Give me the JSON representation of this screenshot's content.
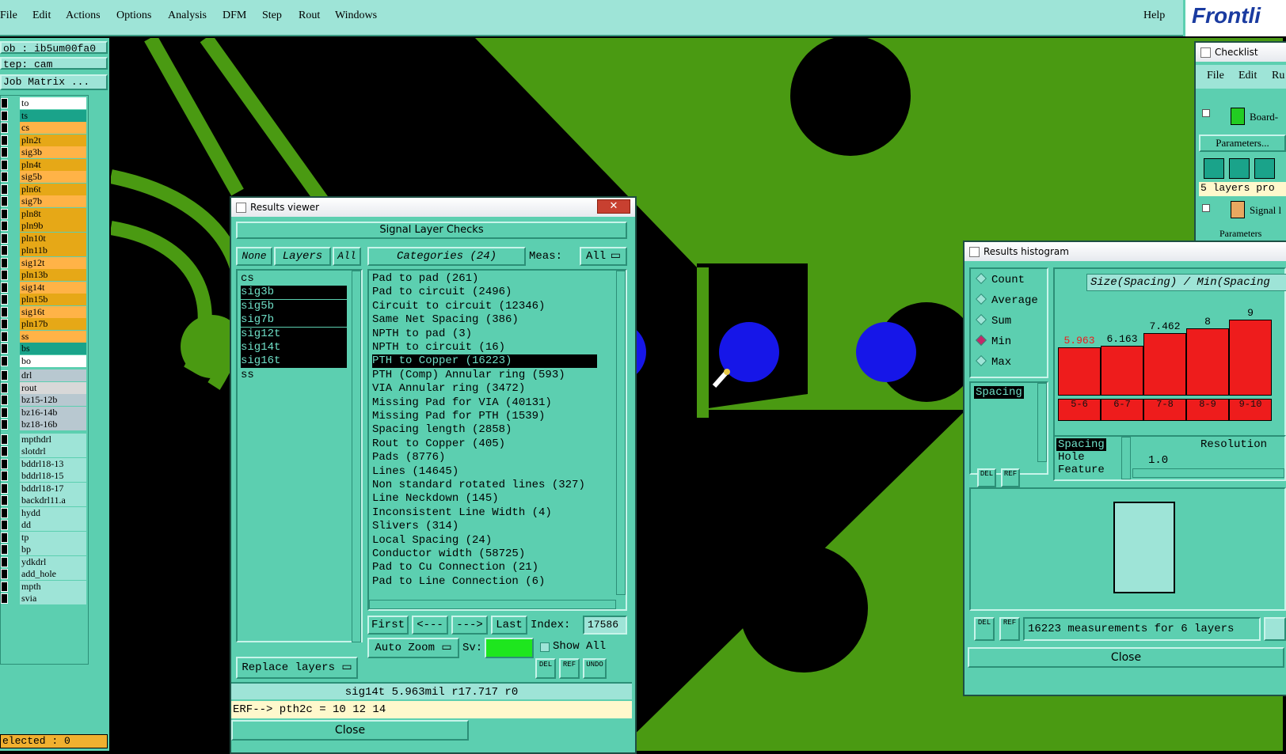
{
  "menubar": {
    "items": [
      "File",
      "Edit",
      "Actions",
      "Options",
      "Analysis",
      "DFM",
      "Step",
      "Rout",
      "Windows"
    ],
    "help": "Help",
    "logo": "Frontli"
  },
  "left": {
    "job": "ob : ib5um00fa0",
    "step": "tep: cam",
    "matrix": "Job Matrix ...",
    "layers_top": [
      {
        "name": "to",
        "color": "#ffffff"
      },
      {
        "name": "ts",
        "color": "#1aa38a"
      },
      {
        "name": "cs",
        "color": "#ffb347"
      },
      {
        "name": "pln2t",
        "color": "#e6a817"
      },
      {
        "name": "sig3b",
        "color": "#ffb347"
      },
      {
        "name": "pln4t",
        "color": "#e6a817"
      },
      {
        "name": "sig5b",
        "color": "#ffb347"
      },
      {
        "name": "pln6t",
        "color": "#e6a817"
      },
      {
        "name": "sig7b",
        "color": "#ffb347"
      },
      {
        "name": "pln8t",
        "color": "#e6a817"
      },
      {
        "name": "pln9b",
        "color": "#e6a817"
      },
      {
        "name": "pln10t",
        "color": "#e6a817"
      },
      {
        "name": "pln11b",
        "color": "#e6a817"
      },
      {
        "name": "sig12t",
        "color": "#ffb347"
      },
      {
        "name": "pln13b",
        "color": "#e6a817"
      },
      {
        "name": "sig14t",
        "color": "#ffb347"
      },
      {
        "name": "pln15b",
        "color": "#e6a817"
      },
      {
        "name": "sig16t",
        "color": "#ffb347"
      },
      {
        "name": "pln17b",
        "color": "#e6a817"
      },
      {
        "name": "ss",
        "color": "#ffb347"
      },
      {
        "name": "bs",
        "color": "#1aa38a"
      },
      {
        "name": "bo",
        "color": "#ffffff"
      }
    ],
    "layers_mid": [
      {
        "name": "drl",
        "color": "#b8c8d0"
      },
      {
        "name": "rout",
        "color": "#d8d8d8"
      },
      {
        "name": "bz15-12b",
        "color": "#b8c8d0"
      },
      {
        "name": "bz16-14b",
        "color": "#b8c8d0"
      },
      {
        "name": "bz18-16b",
        "color": "#b8c8d0"
      }
    ],
    "layers_bot": [
      "mpthdrl",
      "slotdrl",
      "bddrl18-13",
      "bddrl18-15",
      "bddrl18-17",
      "backdrl11.a",
      "hydd",
      "dd",
      "tp",
      "bp",
      "ydkdrl",
      "add_hole",
      "mpth",
      "svia"
    ],
    "selected": "elected : 0"
  },
  "results_viewer": {
    "title": "Results viewer",
    "header": "Signal Layer Checks",
    "btn_none": "None",
    "btn_layers": "Layers",
    "btn_all": "All",
    "categories_label": "Categories (24)",
    "meas_label": "Meas:",
    "meas_value": "All",
    "layers": [
      "cs",
      "sig3b",
      "sig5b",
      "sig7b",
      "sig12t",
      "sig14t",
      "sig16t",
      "ss"
    ],
    "layers_selected": [
      1,
      2,
      3,
      4,
      5,
      6
    ],
    "categories": [
      "Pad to pad (261)",
      "Pad to circuit (2496)",
      "Circuit to circuit (12346)",
      "Same Net Spacing (386)",
      "NPTH to pad (3)",
      "NPTH to circuit (16)",
      "PTH to Copper (16223)",
      "PTH (Comp) Annular ring (593)",
      "VIA Annular ring (3472)",
      "Missing Pad for VIA (40131)",
      "Missing Pad for PTH (1539)",
      "Spacing length (2858)",
      "Rout to Copper (405)",
      "Pads (8776)",
      "Lines (14645)",
      "Non standard rotated lines (327)",
      "Line Neckdown (145)",
      "Inconsistent Line Width (4)",
      "Slivers (314)",
      "Local Spacing (24)",
      "Conductor width (58725)",
      "Pad to Cu Connection (21)",
      "Pad to Line Connection (6)"
    ],
    "category_selected": 6,
    "nav_first": "First",
    "nav_prev": "<---",
    "nav_next": "--->",
    "nav_last": "Last",
    "index_label": "Index:",
    "index_value": "17586",
    "auto_zoom": "Auto Zoom",
    "sv_label": "Sv:",
    "show_all": "Show All",
    "replace_layers": "Replace layers",
    "btn_del": "DEL",
    "btn_ref": "REF",
    "btn_undo": "UNDO",
    "status": "sig14t 5.963mil  r17.717  r0",
    "erf": "ERF--> pth2c = 10 12 14",
    "close": "Close"
  },
  "histogram": {
    "title": "Results histogram",
    "modes": [
      "Count",
      "Average",
      "Sum",
      "Min",
      "Max"
    ],
    "mode_selected": 3,
    "header": "Size(Spacing) / Min(Spacing",
    "list_item": "Spacing",
    "sublist": [
      "Spacing",
      "Hole",
      "Feature"
    ],
    "resolution_label": "Resolution",
    "resolution_value": "1.0",
    "summary": "16223 measurements for 6 layers",
    "close": "Close",
    "btn_del": "DEL",
    "btn_ref": "REF"
  },
  "chart_data": {
    "type": "bar",
    "title": "Size(Spacing) / Min(Spacing",
    "categories": [
      "5-6",
      "6-7",
      "7-8",
      "8-9",
      "9-10"
    ],
    "values": [
      5.963,
      6.163,
      7.462,
      8,
      9
    ],
    "value_labels": [
      "5.963",
      "6.163",
      "7.462",
      "8",
      "9"
    ],
    "color": "#ee1c1c"
  },
  "checklist": {
    "title": "Checklist Editor",
    "menu": [
      "File",
      "Edit",
      "Ru"
    ],
    "item1": "Board-",
    "params": "Parameters...",
    "layers_note": "5 layers pro",
    "item2": "Signal l",
    "params2": "Parameters"
  }
}
